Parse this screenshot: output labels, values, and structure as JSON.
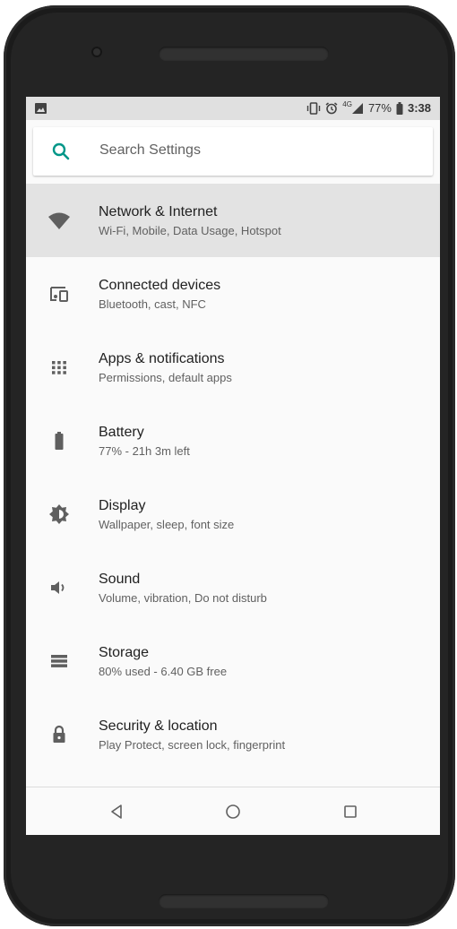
{
  "status_bar": {
    "battery_percent": "77%",
    "time": "3:38",
    "network_type": "4G"
  },
  "search": {
    "label": "Search Settings"
  },
  "settings": [
    {
      "title": "Network & Internet",
      "subtitle": "Wi-Fi, Mobile, Data Usage, Hotspot",
      "icon": "wifi-icon"
    },
    {
      "title": "Connected devices",
      "subtitle": "Bluetooth, cast, NFC",
      "icon": "devices-icon"
    },
    {
      "title": "Apps & notifications",
      "subtitle": "Permissions, default apps",
      "icon": "apps-icon"
    },
    {
      "title": "Battery",
      "subtitle": "77% - 21h 3m left",
      "icon": "battery-icon"
    },
    {
      "title": "Display",
      "subtitle": "Wallpaper, sleep, font size",
      "icon": "brightness-icon"
    },
    {
      "title": "Sound",
      "subtitle": "Volume, vibration, Do not disturb",
      "icon": "volume-icon"
    },
    {
      "title": "Storage",
      "subtitle": "80% used - 6.40 GB free",
      "icon": "storage-icon"
    },
    {
      "title": "Security & location",
      "subtitle": "Play Protect, screen lock, fingerprint",
      "icon": "lock-icon"
    }
  ],
  "colors": {
    "accent": "#009688",
    "highlight": "#e3e3e3",
    "icon": "#5f5f5f"
  }
}
